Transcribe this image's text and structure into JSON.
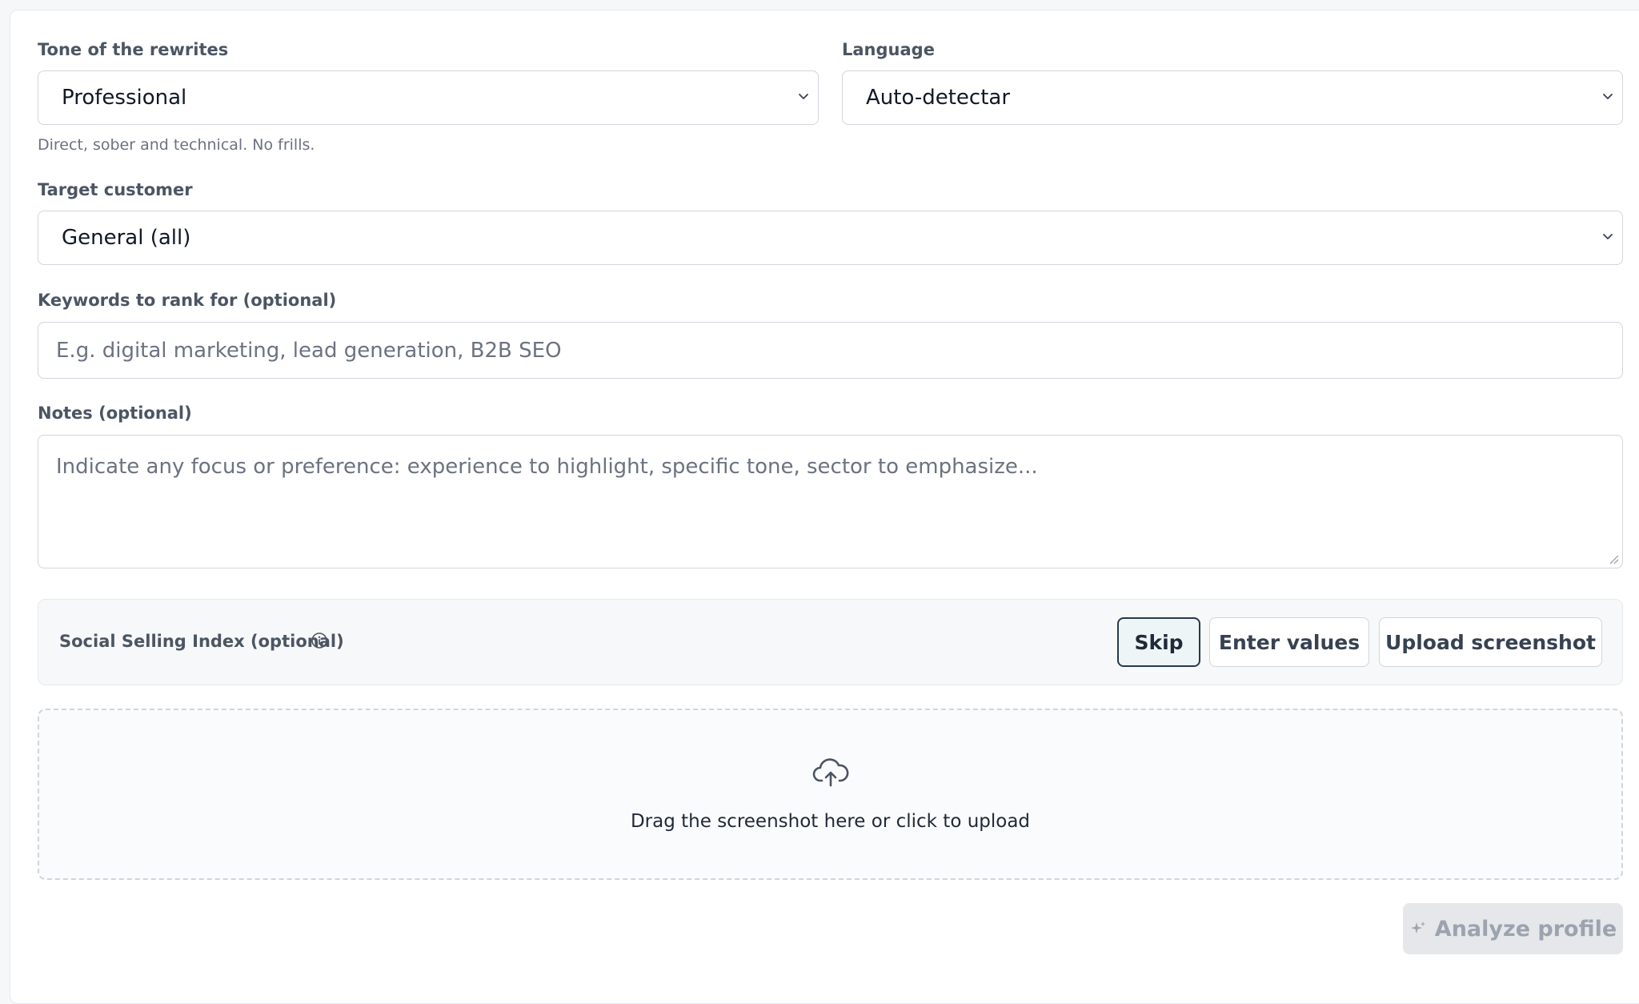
{
  "form": {
    "tone": {
      "label": "Tone of the rewrites",
      "value": "Professional",
      "help": "Direct, sober and technical. No frills."
    },
    "language": {
      "label": "Language",
      "value": "Auto-detectar"
    },
    "target": {
      "label": "Target customer",
      "value": "General (all)"
    },
    "keywords": {
      "label": "Keywords to rank for (optional)",
      "placeholder": "E.g. digital marketing, lead generation, B2B SEO"
    },
    "notes": {
      "label": "Notes (optional)",
      "placeholder": "Indicate any focus or preference: experience to highlight, specific tone, sector to emphasize..."
    },
    "ssi": {
      "label": "Social Selling Index (optional)",
      "buttons": {
        "skip": "Skip",
        "enter": "Enter values",
        "upload": "Upload screenshot"
      },
      "selected": "Skip"
    },
    "dropzone": {
      "text": "Drag the screenshot here or click to upload"
    },
    "analyze_label": "Analyze profile"
  },
  "colors": {
    "active_border": "#26394a",
    "active_bg": "#eef5f7",
    "disabled_bg": "#e5e7ea",
    "disabled_text": "#9ca3af"
  }
}
